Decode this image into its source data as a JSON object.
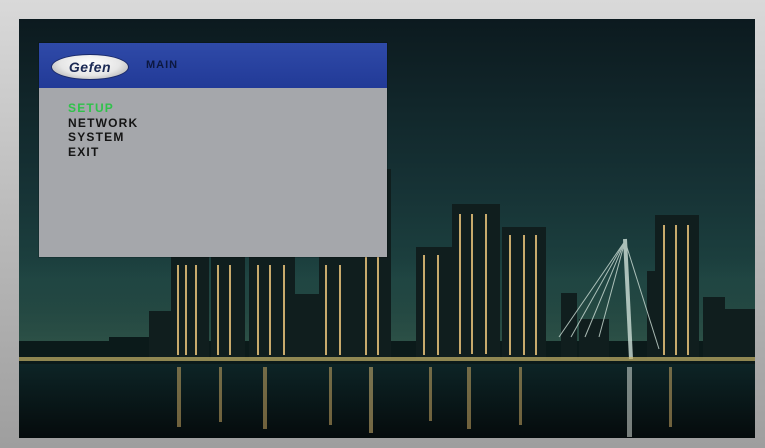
{
  "osd": {
    "logo_text": "Gefen",
    "title": "MAIN",
    "menu": [
      {
        "label": "SETUP",
        "selected": true
      },
      {
        "label": "NETWORK",
        "selected": false
      },
      {
        "label": "SYSTEM",
        "selected": false
      },
      {
        "label": "EXIT",
        "selected": false
      }
    ]
  },
  "colors": {
    "header_blue": "#223a97",
    "panel_gray": "#a5a7ab",
    "selected_green": "#2fc24a",
    "menu_text": "#141414"
  }
}
